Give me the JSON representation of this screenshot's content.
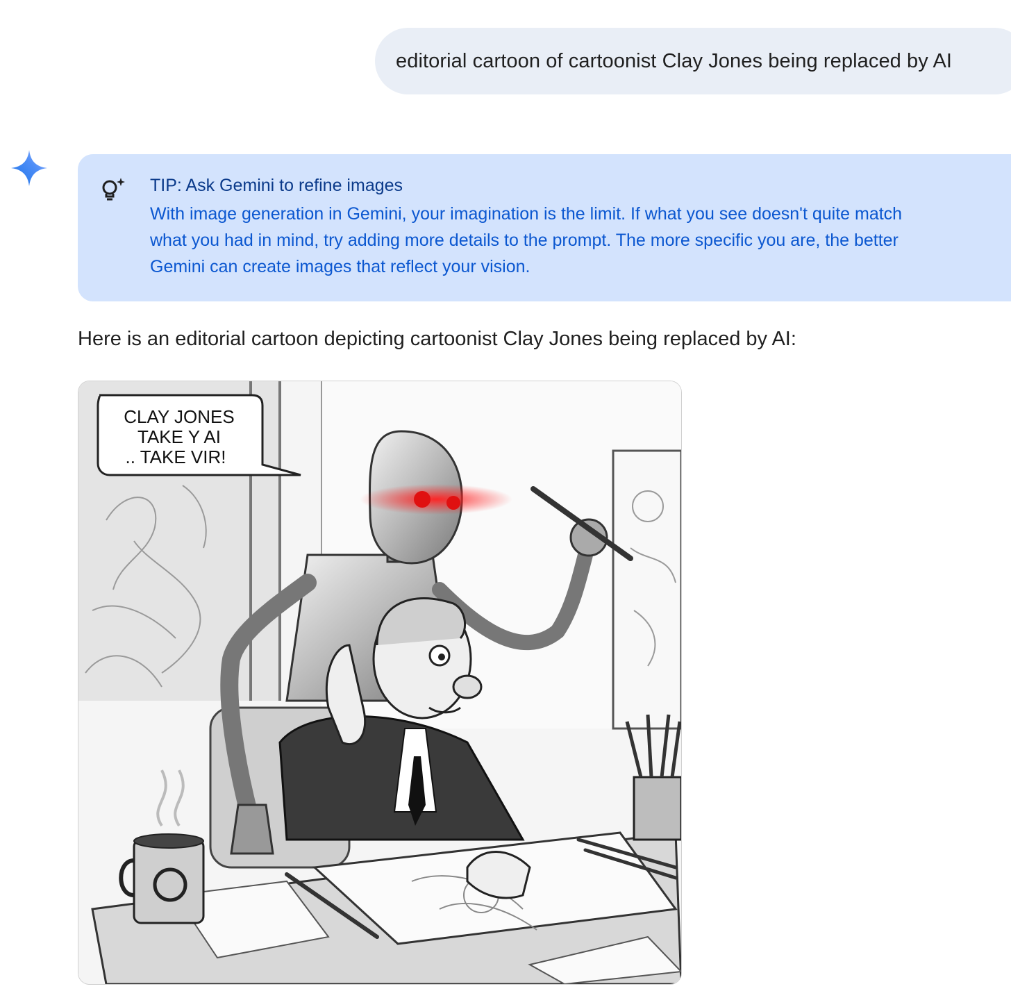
{
  "conversation": {
    "user_prompt": "editorial cartoon of cartoonist Clay Jones being replaced by AI",
    "tip": {
      "icon": "lightbulb-sparkle-icon",
      "title": "TIP: Ask Gemini to refine images",
      "body_lines": [
        "With image generation in Gemini, your imagination is the limit. If what you see doesn't quite match",
        "what you had in mind, try adding more details to the prompt. The more specific you are, the better",
        "Gemini can create images that reflect your vision."
      ]
    },
    "response_text": "Here is an editorial cartoon depicting cartoonist Clay Jones being replaced by AI:",
    "image": {
      "speech_bubble_lines": [
        "CLAY JONES",
        "TAKE Y AI",
        ".. TAKE VIR!"
      ]
    }
  },
  "icons": {
    "assistant": "gemini-spark-icon"
  },
  "colors": {
    "user_bubble": "#e9eef6",
    "tip_background": "#d3e3fd",
    "tip_title": "#0b3a8a",
    "tip_text": "#0b57d0",
    "robot_eyes": "#e01010"
  }
}
